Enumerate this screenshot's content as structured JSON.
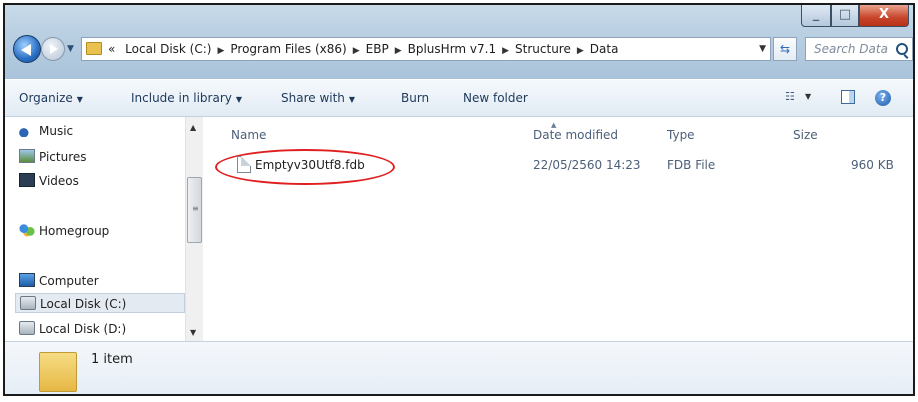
{
  "window": {
    "minimize": "_",
    "maximize": "□",
    "close": "X"
  },
  "address_bar": {
    "overflow": "«",
    "crumbs": [
      "Local Disk (C:)",
      "Program Files (x86)",
      "EBP",
      "BplusHrm v7.1",
      "Structure",
      "Data"
    ]
  },
  "search": {
    "placeholder": "Search Data"
  },
  "toolbar": {
    "organize": "Organize",
    "include_in_library": "Include in library",
    "share_with": "Share with",
    "burn": "Burn",
    "new_folder": "New folder"
  },
  "navigation": {
    "items": [
      {
        "label": "Music",
        "icon": "music-icon"
      },
      {
        "label": "Pictures",
        "icon": "pictures-icon"
      },
      {
        "label": "Videos",
        "icon": "videos-icon"
      },
      {
        "label": "Homegroup",
        "icon": "homegroup-icon"
      },
      {
        "label": "Computer",
        "icon": "computer-icon"
      },
      {
        "label": "Local Disk (C:)",
        "icon": "disk-icon",
        "selected": true
      },
      {
        "label": "Local Disk (D:)",
        "icon": "disk-icon"
      }
    ]
  },
  "columns": {
    "name": "Name",
    "date_modified": "Date modified",
    "type": "Type",
    "size": "Size"
  },
  "files": [
    {
      "name": "Emptyv30Utf8.fdb",
      "date_modified": "22/05/2560 14:23",
      "type": "FDB File",
      "size": "960 KB",
      "highlighted": true
    }
  ],
  "details": {
    "item_count": "1 item"
  },
  "colors": {
    "highlight_circle": "#e02020",
    "accent": "#1e395b"
  }
}
